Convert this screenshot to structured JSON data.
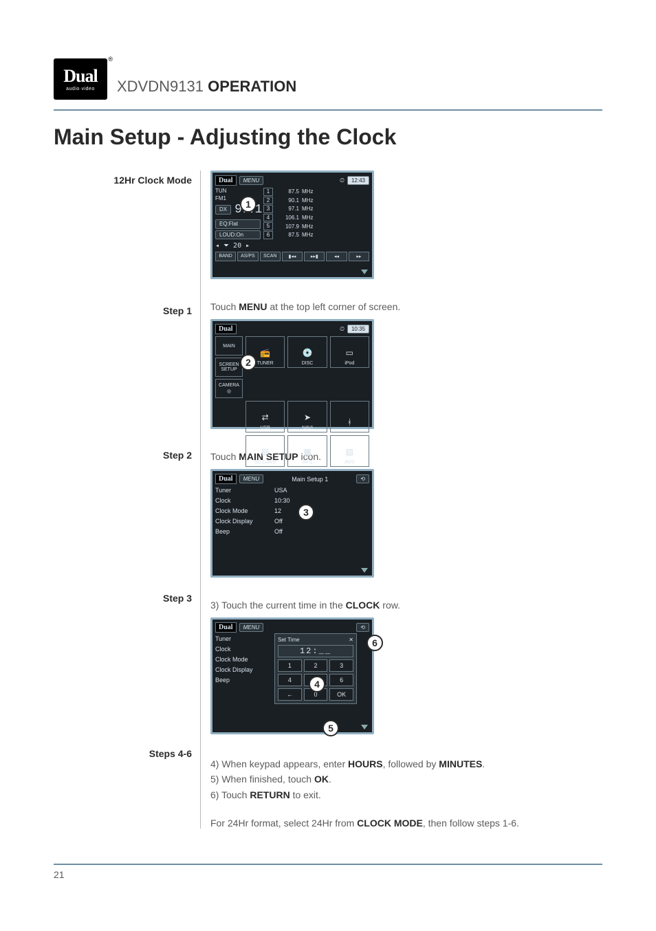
{
  "brand": {
    "name": "Dual",
    "sub": "audio·video",
    "reg": "®"
  },
  "header": {
    "model": "XDVDN9131",
    "section": "OPERATION"
  },
  "title": "Main Setup - Adjusting the Clock",
  "page_number": "21",
  "labels": {
    "clock_mode": "12Hr Clock Mode",
    "step1": "Step 1",
    "step2": "Step 2",
    "step3": "Step 3",
    "steps46": "Steps 4-6"
  },
  "step1_pre": "Touch ",
  "step1_b": "MENU",
  "step1_post": " at the top left corner of screen.",
  "step2_pre": "Touch ",
  "step2_b": "MAIN SETUP",
  "step2_post": " icon.",
  "step3_pre": "3) Touch the current time in the ",
  "step3_b": "CLOCK",
  "step3_post": " row.",
  "steps46_l1_a": "4) When keypad appears, enter ",
  "steps46_l1_b": "HOURS",
  "steps46_l1_c": ", followed by ",
  "steps46_l1_d": "MINUTES",
  "steps46_l1_e": ".",
  "steps46_l2_a": "5) When finished, touch ",
  "steps46_l2_b": "OK",
  "steps46_l2_c": ".",
  "steps46_l3_a": "6) Touch ",
  "steps46_l3_b": "RETURN",
  "steps46_l3_c": " to exit.",
  "note_pre": "For 24Hr format, select 24Hr from ",
  "note_b": "CLOCK MODE",
  "note_post": ", then follow steps 1-6.",
  "markers": {
    "m1": "1",
    "m2": "2",
    "m3": "3",
    "m4": "4",
    "m5": "5",
    "m6": "6"
  },
  "screen1": {
    "dual": "Dual",
    "menu": "MENU",
    "clock_icon": "⏲",
    "time": "12:43",
    "tun": "TUN",
    "band_label": "FM1",
    "dx": "DX",
    "freq": "97.1",
    "eq": "EQ:Flat",
    "loud": "LOUD:On",
    "vol": "◂ ⏷ 20 ▸",
    "presets": [
      {
        "n": "1",
        "f": "87.5",
        "u": "MHz"
      },
      {
        "n": "2",
        "f": "90.1",
        "u": "MHz"
      },
      {
        "n": "3",
        "f": "97.1",
        "u": "MHz"
      },
      {
        "n": "4",
        "f": "106.1",
        "u": "MHz"
      },
      {
        "n": "5",
        "f": "107.9",
        "u": "MHz"
      },
      {
        "n": "6",
        "f": "87.5",
        "u": "MHz"
      }
    ],
    "buttons": {
      "band": "BAND",
      "asps": "AS/PS",
      "scan": "SCAN",
      "prev": "▮◂◂",
      "next": "▸▸▮",
      "rew": "◂◂",
      "ff": "▸▸"
    }
  },
  "screen2": {
    "dual": "Dual",
    "clock_icon": "⏲",
    "time": "10:35",
    "side": {
      "main": "MAIN",
      "setup": "SCREEN\nSETUP",
      "camera": "CAMERA"
    },
    "tiles": {
      "tuner": "TUNER",
      "disc": "DISC",
      "ipod": "iPod",
      "usb": "USB",
      "navi": "NAVI",
      "bt": "",
      "sdcard": "SD CARD",
      "av1": "AV/1",
      "av2": "AV/2"
    },
    "icons": {
      "tuner": "📻",
      "disc": "💿",
      "ipod": "▭",
      "usb": "⇄",
      "navi": "➤",
      "bt": "ᚼ",
      "sdcard": "▤",
      "av1": "▦",
      "av2": "▧",
      "camera": "◎"
    }
  },
  "screen3": {
    "dual": "Dual",
    "menu": "MENU",
    "title": "Main  Setup 1",
    "return": "⟲",
    "rows": {
      "tuner_k": "Tuner",
      "tuner_v": "USA",
      "clock_k": "Clock",
      "clock_v": "10:30",
      "mode_k": "Clock Mode",
      "mode_v": "12",
      "disp_k": "Clock Display",
      "disp_v": "Off",
      "beep_k": "Beep",
      "beep_v": "Off"
    }
  },
  "screen4": {
    "dual": "Dual",
    "menu": "MENU",
    "return": "⟲",
    "rows": {
      "tuner_k": "Tuner",
      "clock_k": "Clock",
      "mode_k": "Clock Mode",
      "disp_k": "Clock Display",
      "beep_k": "Beep"
    },
    "keypad": {
      "title": "Set Time",
      "close": "✕",
      "display": "12:__",
      "keys": {
        "k1": "1",
        "k2": "2",
        "k3": "3",
        "k4": "4",
        "k5": "5",
        "k6": "6",
        "kback": "←",
        "k0": "0",
        "kok": "OK"
      }
    }
  }
}
